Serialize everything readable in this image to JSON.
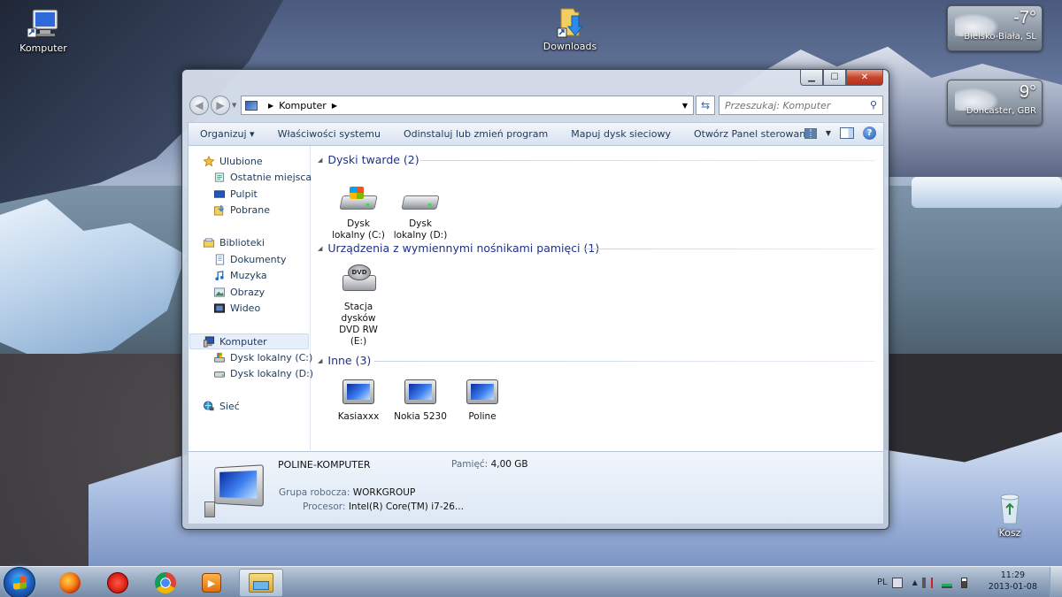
{
  "desktop": {
    "icons": [
      {
        "label": "Komputer",
        "icon": "computer-icon"
      },
      {
        "label": "Downloads",
        "icon": "folder-shortcut-icon"
      },
      {
        "label": "Kosz",
        "icon": "recycle-bin-icon"
      }
    ],
    "gadgets": [
      {
        "temp": "-7°",
        "city": "Bielsko-Biała, SL"
      },
      {
        "temp": "9°",
        "city": "Doncaster, GBR"
      }
    ]
  },
  "window": {
    "address": {
      "location": "Komputer"
    },
    "search": {
      "placeholder": "Przeszukaj: Komputer"
    },
    "toolbar": {
      "organize": "Organizuj ▾",
      "system_properties": "Właściwości systemu",
      "uninstall": "Odinstaluj lub zmień program",
      "map_drive": "Mapuj dysk sieciowy",
      "control_panel": "Otwórz Panel sterowania"
    },
    "nav": {
      "favorites": "Ulubione",
      "recent": "Ostatnie miejsca",
      "desktop": "Pulpit",
      "downloads": "Pobrane",
      "libraries": "Biblioteki",
      "documents": "Dokumenty",
      "music": "Muzyka",
      "pictures": "Obrazy",
      "videos": "Wideo",
      "computer": "Komputer",
      "drive_c": "Dysk lokalny (C:)",
      "drive_d": "Dysk lokalny (D:)",
      "network": "Sieć"
    },
    "groups": {
      "hard_drives": "Dyski twarde (2)",
      "removable": "Urządzenia z wymiennymi nośnikami pamięci (1)",
      "other": "Inne (3)"
    },
    "items": {
      "drive_c_l1": "Dysk",
      "drive_c_l2": "lokalny (C:)",
      "drive_d_l1": "Dysk",
      "drive_d_l2": "lokalny (D:)",
      "dvd_l1": "Stacja",
      "dvd_l2": "dysków",
      "dvd_l3": "DVD RW",
      "dvd_l4": "(E:)",
      "dvd_label": "DVD",
      "other_1": "Kasiaxxx",
      "other_2": "Nokia 5230",
      "other_3": "Poline"
    },
    "details": {
      "computer_name": "POLINE-KOMPUTER",
      "memory_label": "Pamięć:",
      "memory_value": "4,00 GB",
      "workgroup_label": "Grupa robocza:",
      "workgroup_value": "WORKGROUP",
      "cpu_label": "Procesor:",
      "cpu_value": "Intel(R) Core(TM) i7-26..."
    }
  },
  "taskbar": {
    "apps": [
      "firefox-icon",
      "blocked-app-icon",
      "chrome-icon",
      "media-player-icon",
      "explorer-icon"
    ],
    "tray": {
      "lang": "PL"
    },
    "clock": {
      "time": "11:29",
      "date": "2013-01-08"
    }
  }
}
